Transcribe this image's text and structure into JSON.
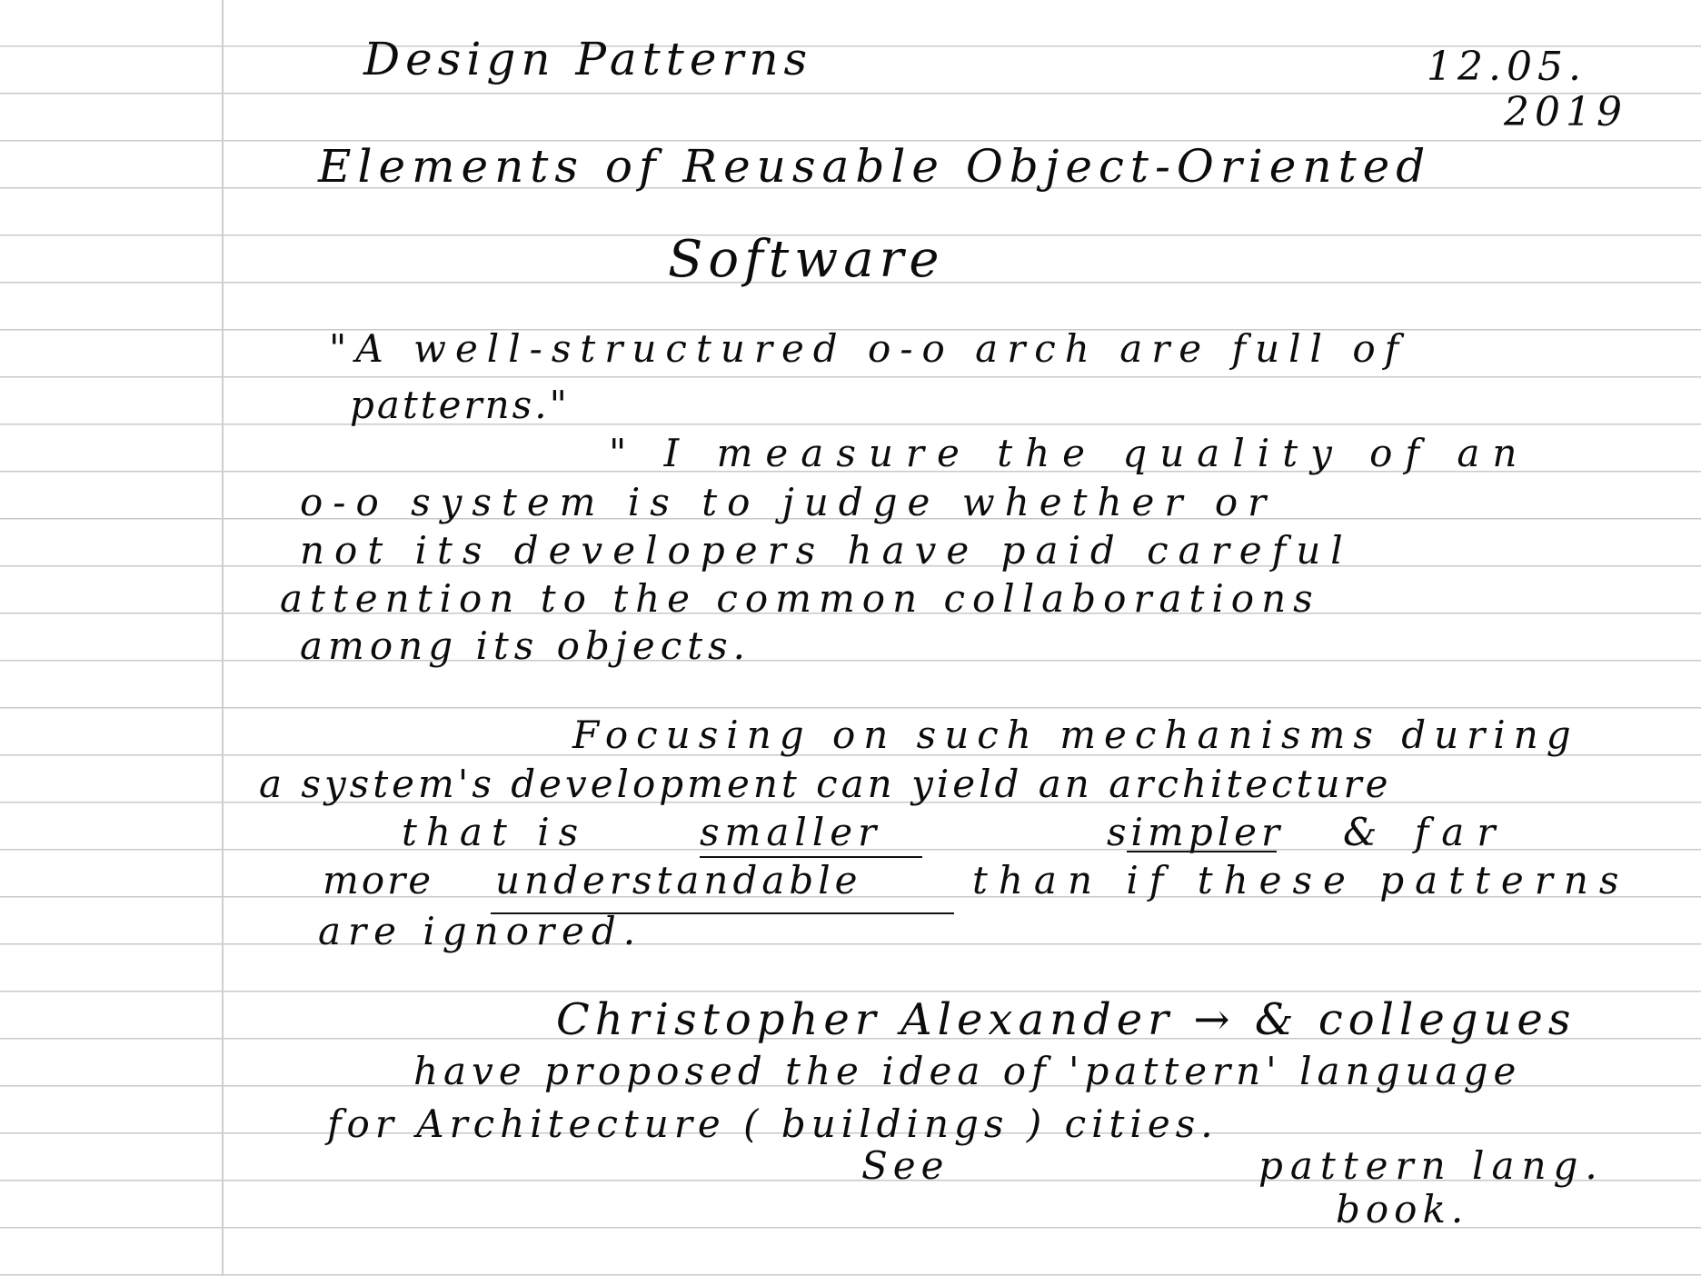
{
  "title": {
    "line1": "Design Patterns",
    "line2": "Elements of Reusable Object-Oriented",
    "line3": "Software"
  },
  "date": {
    "top": "12.05.",
    "bottom": "2019"
  },
  "quote1": {
    "line1": "\"A well-structured o-o arch are full of",
    "line2": "patterns.\""
  },
  "quote2": {
    "line1": "\" I measure the quality of an",
    "line2": "o-o system is to judge whether or",
    "line3": "not its developers have paid careful",
    "line4": "attention to the common collaborations",
    "line5": "among its objects."
  },
  "para": {
    "line1": "Focusing on such mechanisms during",
    "line2": "a system's development can yield an architecture",
    "line3a": "that is",
    "line3b": "smaller",
    "line3c": "simpler",
    "line3d": "& far",
    "line4a": "more",
    "line4b": "understandable",
    "line4c": "than if these patterns",
    "line5": "are ignored."
  },
  "alexander": {
    "line1": "Christopher Alexander → & collegues",
    "line2": "have proposed the idea of 'pattern' language",
    "line3": "for Architecture ( buildings ) cities.",
    "see": "See",
    "ref1": "pattern lang.",
    "ref2": "book."
  }
}
